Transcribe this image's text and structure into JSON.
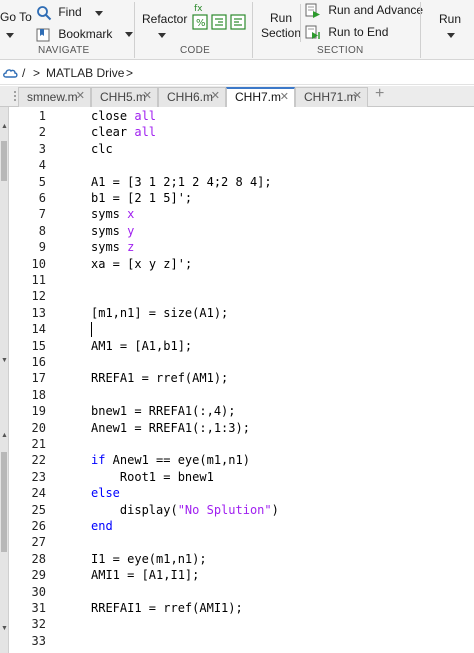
{
  "toolstrip": {
    "goto_label": "Go To",
    "find_label": "Find",
    "bookmark_label": "Bookmark",
    "navigate_section": "NAVIGATE",
    "refactor_label": "Refactor",
    "code_section": "CODE",
    "run_section_line1": "Run",
    "run_section_line2": "Section",
    "run_advance_label": "Run and Advance",
    "run_to_end_label": "Run to End",
    "section_section": "SECTION",
    "run_label": "Run"
  },
  "address": {
    "separator": "/",
    "chevron": ">",
    "location": "MATLAB Drive",
    "chevron2": ">"
  },
  "tabs": [
    {
      "label": "smnew.m",
      "active": false
    },
    {
      "label": "CHH5.m",
      "active": false
    },
    {
      "label": "CHH6.m",
      "active": false
    },
    {
      "label": "CHH7.m",
      "active": true
    },
    {
      "label": "CHH71.m",
      "active": false
    }
  ],
  "add_tab_glyph": "+",
  "code_lines": [
    "close all",
    "clear all",
    "clc",
    "",
    "A1 = [3 1 2;1 2 4;2 8 4];",
    "b1 = [2 1 5]';",
    "syms x",
    "syms y",
    "syms z",
    "xa = [x y z]';",
    "",
    "",
    "[m1,n1] = size(A1);",
    "",
    "AM1 = [A1,b1];",
    "",
    "RREFA1 = rref(AM1);",
    "",
    "bnew1 = RREFA1(:,4);",
    "Anew1 = RREFA1(:,1:3);",
    "",
    "if Anew1 == eye(m1,n1)",
    "    Root1 = bnew1",
    "else",
    "    display(\"No Splution\")",
    "end",
    "",
    "I1 = eye(m1,n1);",
    "AMI1 = [A1,I1];",
    "",
    "RREFAI1 = rref(AMI1);",
    "",
    ""
  ],
  "colors": {
    "keyword": "#0000ff",
    "string": "#a020f0",
    "active_tab_accent": "#3c78c8"
  }
}
